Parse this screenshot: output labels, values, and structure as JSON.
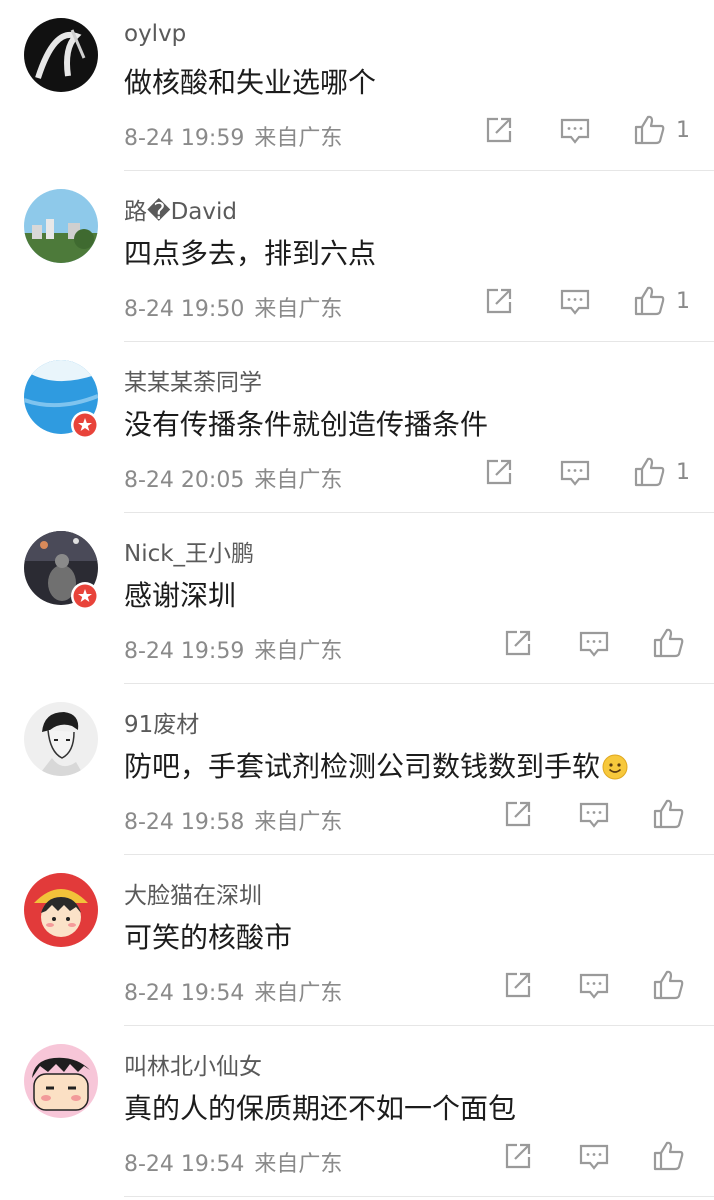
{
  "comments": [
    {
      "username": "oylvp",
      "text": "做核酸和失业选哪个",
      "time": "8-24 19:59",
      "location": "来自广东",
      "likes": "1"
    },
    {
      "username": "路�David",
      "text": "四点多去，排到六点",
      "time": "8-24 19:50",
      "location": "来自广东",
      "likes": "1"
    },
    {
      "username": "某某某荼同学",
      "text": "没有传播条件就创造传播条件",
      "time": "8-24 20:05",
      "location": "来自广东",
      "likes": "1"
    },
    {
      "username": "Nick_王小鹏",
      "text": "感谢深圳",
      "time": "8-24 19:59",
      "location": "来自广东",
      "likes": ""
    },
    {
      "username": "91废材",
      "text": "防吧，手套试剂检测公司数钱数到手软",
      "time": "8-24 19:58",
      "location": "来自广东",
      "likes": ""
    },
    {
      "username": "大脸猫在深圳",
      "text": "可笑的核酸市",
      "time": "8-24 19:54",
      "location": "来自广东",
      "likes": ""
    },
    {
      "username": "叫林北小仙女",
      "text": "真的人的保质期还不如一个面包",
      "time": "8-24 19:54",
      "location": "来自广东",
      "likes": ""
    }
  ],
  "colors": {
    "text": "#1c1c1c",
    "username": "#5a5a5a",
    "meta": "#8a8a8a",
    "icon": "#9a9a9a",
    "divider": "#e6e6e6",
    "badge": "#e8433a"
  },
  "icons": {
    "share": "share-icon",
    "comment": "comment-icon",
    "like": "thumbs-up-icon",
    "verified": "verified-badge-icon",
    "emoji": "smiley-emoji"
  }
}
